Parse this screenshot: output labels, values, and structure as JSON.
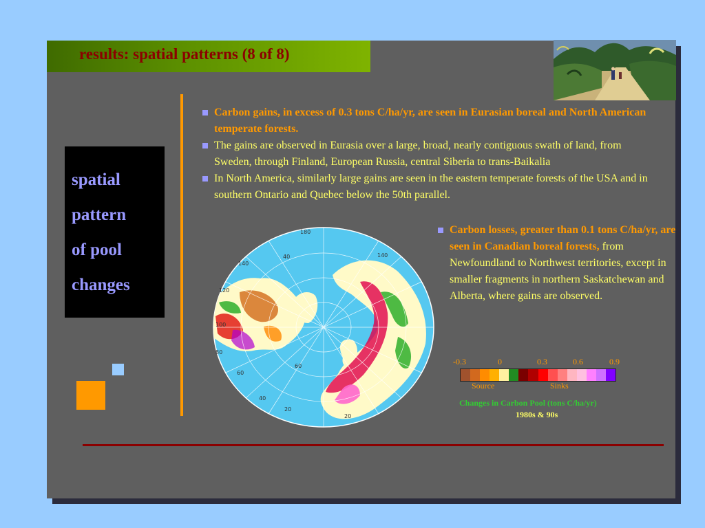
{
  "title": "results: spatial patterns (8 of 8)",
  "sidebar": {
    "lines": [
      "spatial",
      "pattern",
      "of pool",
      "changes"
    ]
  },
  "bullets": [
    {
      "text": "Carbon gains, in excess of 0.3 tons C/ha/yr, are seen in Eurasian boreal and North American temperate forests."
    },
    {
      "text": "The gains are observed in Eurasia over a large, broad, nearly contiguous swath of land, from Sweden, through Finland, European Russia, central Siberia to trans-Baikalia"
    },
    {
      "text": "In North America, similarly large gains are seen in the eastern temperate forests of the USA and in southern Ontario and Quebec below the 50th parallel."
    }
  ],
  "bullet4": {
    "bold": "Carbon losses, greater than 0.1 tons C/ha/yr, are seen in Canadian boreal forests,",
    "rest": " from Newfoundland to Northwest territories, except in smaller fragments in northern Saskatchewan and Alberta, where gains are observed."
  },
  "legend": {
    "ticks": [
      "-0.3",
      "0",
      "0.3",
      "0.6",
      "0.9"
    ],
    "source_label": "Source",
    "sinks_label": "Sinks",
    "caption_line1": "Changes in Carbon Pool (tons C/ha/yr)",
    "caption_line2": "1980s & 90s",
    "colors": [
      "#a0522d",
      "#d2691e",
      "#ff8c00",
      "#ffb000",
      "#fff0a0",
      "#228b22",
      "#7a0000",
      "#b00000",
      "#ff0000",
      "#ff5050",
      "#ff8080",
      "#ffb6c1",
      "#ffc0e0",
      "#ff80ff",
      "#d070ff",
      "#8000ff"
    ]
  },
  "map": {
    "grid_labels": [
      "180",
      "40",
      "140",
      "140",
      "120",
      "100",
      "80",
      "60",
      "60",
      "40",
      "20",
      "20"
    ],
    "ocean_color": "#55c8f0",
    "land_color": "#fffac8"
  },
  "colors": {
    "slide_bg": "#5f5f5f",
    "page_bg": "#99ccff",
    "title_color": "#8b0000",
    "accent_orange": "#ff9900",
    "text_yellow": "#ffff66",
    "bullet_color": "#9999ff"
  }
}
